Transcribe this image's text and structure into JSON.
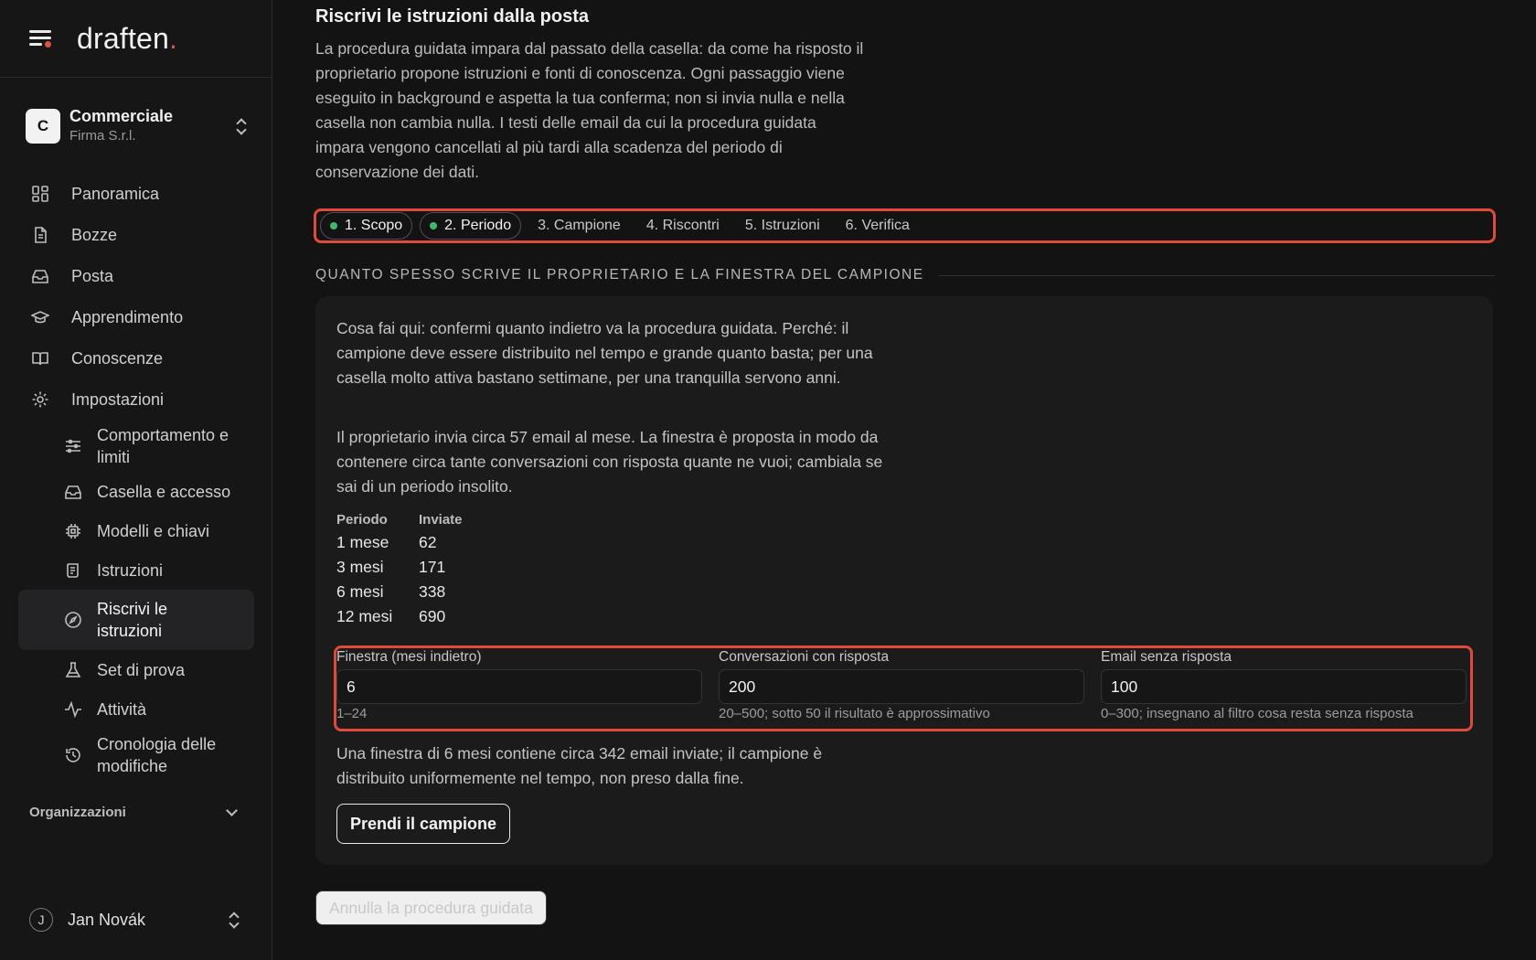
{
  "brand": {
    "name": "draften",
    "dot": "."
  },
  "org": {
    "initial": "C",
    "name": "Commerciale",
    "company": "Firma S.r.l."
  },
  "nav": {
    "panoramica": "Panoramica",
    "bozze": "Bozze",
    "posta": "Posta",
    "apprendimento": "Apprendimento",
    "conoscenze": "Conoscenze",
    "impostazioni": "Impostazioni",
    "comportamento": "Comportamento e limiti",
    "casella": "Casella e accesso",
    "modelli": "Modelli e chiavi",
    "istruzioni": "Istruzioni",
    "riscrivi": "Riscrivi le istruzioni",
    "set_prova": "Set di prova",
    "attivita": "Attività",
    "cronologia": "Cronologia delle modifiche"
  },
  "organizzazioni": "Organizzazioni",
  "user": {
    "initial": "J",
    "name": "Jan Novák"
  },
  "page": {
    "title": "Riscrivi le istruzioni dalla posta",
    "intro": "La procedura guidata impara dal passato della casella: da come ha risposto il proprietario propone istruzioni e fonti di conoscenza. Ogni passaggio viene eseguito in background e aspetta la tua conferma; non si invia nulla e nella casella non cambia nulla. I testi delle email da cui la procedura guidata impara vengono cancellati al più tardi alla scadenza del periodo di conservazione dei dati."
  },
  "steps": [
    {
      "label": "1. Scopo",
      "done": true
    },
    {
      "label": "2. Periodo",
      "done": true
    },
    {
      "label": "3. Campione",
      "done": false
    },
    {
      "label": "4. Riscontri",
      "done": false
    },
    {
      "label": "5. Istruzioni",
      "done": false
    },
    {
      "label": "6. Verifica",
      "done": false
    }
  ],
  "section": {
    "title": "QUANTO SPESSO SCRIVE IL PROPRIETARIO E LA FINESTRA DEL CAMPIONE",
    "para1": "Cosa fai qui: confermi quanto indietro va la procedura guidata. Perché: il campione deve essere distribuito nel tempo e grande quanto basta; per una casella molto attiva bastano settimane, per una tranquilla servono anni.",
    "para2": "Il proprietario invia circa 57 email al mese. La finestra è proposta in modo da contenere circa tante conversazioni con risposta quante ne vuoi; cambiala se sai di un periodo insolito.",
    "table": {
      "headers": [
        "Periodo",
        "Inviate"
      ],
      "rows": [
        [
          "1 mese",
          "62"
        ],
        [
          "3 mesi",
          "171"
        ],
        [
          "6 mesi",
          "338"
        ],
        [
          "12 mesi",
          "690"
        ]
      ]
    },
    "fields": [
      {
        "label": "Finestra (mesi indietro)",
        "value": "6",
        "hint": "1–24"
      },
      {
        "label": "Conversazioni con risposta",
        "value": "200",
        "hint": "20–500; sotto 50 il risultato è approssimativo"
      },
      {
        "label": "Email senza risposta",
        "value": "100",
        "hint": "0–300; insegnano al filtro cosa resta senza risposta"
      }
    ],
    "summary": "Una finestra di 6 mesi contiene circa 342 email inviate; il campione è distribuito uniformemente nel tempo, non preso dalla fine.",
    "cta": "Prendi il campione"
  },
  "cancel": "Annulla la procedura guidata",
  "colors": {
    "accent": "#e0523e",
    "highlight": "#e04a3a",
    "done_dot": "#3cba6f"
  }
}
